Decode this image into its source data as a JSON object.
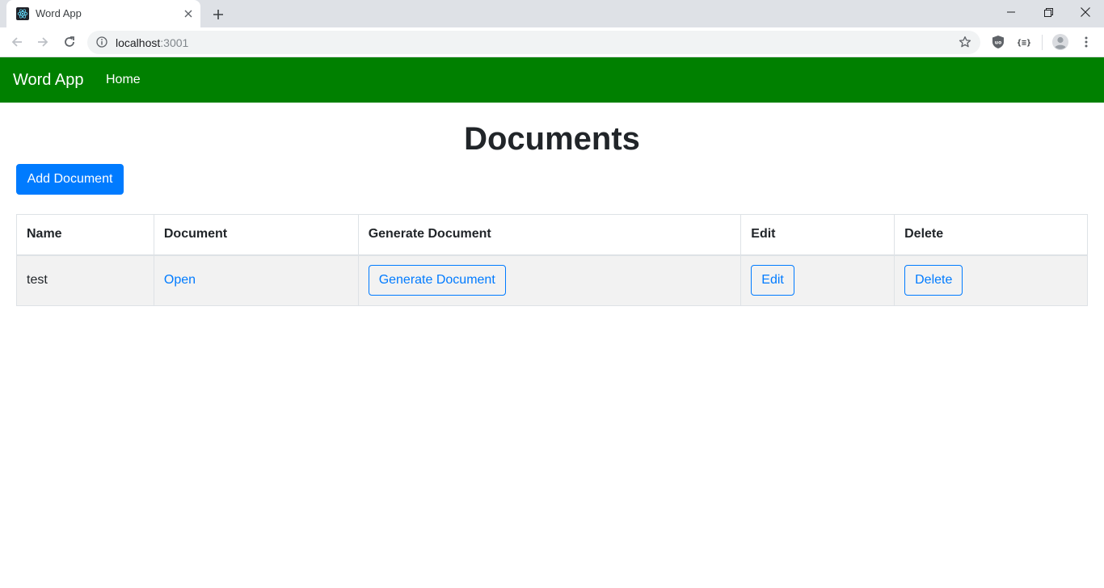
{
  "browser": {
    "tab_title": "Word App",
    "url_host": "localhost",
    "url_port": ":3001",
    "icons": {
      "favicon": "react-icon",
      "tab_close": "close-icon",
      "new_tab": "plus-icon",
      "back": "arrow-left-icon",
      "forward": "arrow-right-icon",
      "reload": "reload-icon",
      "site_info": "info-icon",
      "bookmark": "star-icon",
      "extension_shield": "shield-icon",
      "extension_json": "braces-icon",
      "profile": "avatar-icon",
      "menu": "kebab-menu-icon"
    }
  },
  "navbar": {
    "brand": "Word App",
    "links": [
      {
        "label": "Home"
      }
    ],
    "color": "#008000"
  },
  "main": {
    "title": "Documents",
    "add_button": "Add Document",
    "table": {
      "columns": [
        "Name",
        "Document",
        "Generate Document",
        "Edit",
        "Delete"
      ],
      "rows": [
        {
          "name": "test",
          "document_link": "Open",
          "generate_button": "Generate Document",
          "edit_button": "Edit",
          "delete_button": "Delete"
        }
      ]
    }
  },
  "colors": {
    "primary": "#007bff",
    "navbar": "#008000",
    "row_stripe": "#f2f2f2"
  }
}
